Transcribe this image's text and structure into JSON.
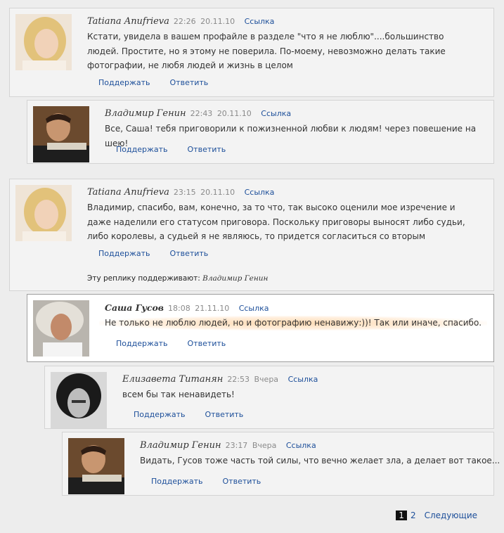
{
  "comments": [
    {
      "author": "Tatiana Anufrieva",
      "time": "22:26",
      "date": "20.11.10",
      "link": "Ссылка",
      "text": "Кстати, увидела в вашем профайле в разделе \"что я не люблю\"....большинство людей. Простите, но я этому не поверила. По-моему, невозможно делать такие фотографии, не любя людей и жизнь в целом",
      "support": "Поддержать",
      "reply": "Ответить"
    },
    {
      "author": "Владимир Генин",
      "time": "22:43",
      "date": "20.11.10",
      "link": "Ссылка",
      "text": "Все, Саша! тебя приговорили к пожизненной любви к людям! через повешение на шею!",
      "support": "Поддержать",
      "reply": "Ответить"
    },
    {
      "author": "Tatiana Anufrieva",
      "time": "23:15",
      "date": "20.11.10",
      "link": "Ссылка",
      "text": "Владимир, спасибо, вам, конечно, за то что, так высоко оценили мое изречение и даже наделили его статусом приговора. Поскольку приговоры выносят либо судьи, либо королевы, а судьей я не являюсь, то придется согласиться со вторым",
      "support": "Поддержать",
      "reply": "Ответить",
      "supported_by_label": "Эту реплику поддерживают:",
      "supported_by": "Владимир Генин"
    },
    {
      "author": "Саша Гусов",
      "time": "18:08",
      "date": "21.11.10",
      "link": "Ссылка",
      "text": "Не только не люблю людей, но и фотографию ненавижу:))! Так или иначе, спасибо.",
      "support": "Поддержать",
      "reply": "Ответить"
    },
    {
      "author": "Елизавета Титанян",
      "time": "22:53",
      "date": "Вчера",
      "link": "Ссылка",
      "text": "всем бы так ненавидеть!",
      "support": "Поддержать",
      "reply": "Ответить"
    },
    {
      "author": "Владимир Генин",
      "time": "23:17",
      "date": "Вчера",
      "link": "Ссылка",
      "text": "Видать, Гусов тоже часть той силы, что вечно желает зла, а делает вот такое...",
      "support": "Поддержать",
      "reply": "Ответить"
    }
  ],
  "pagination": {
    "current": "1",
    "page2": "2",
    "next": "Следующие"
  },
  "colors": {
    "link": "#1d4f9a",
    "card_bg": "#f3f3f3",
    "page_bg": "#ededed"
  }
}
